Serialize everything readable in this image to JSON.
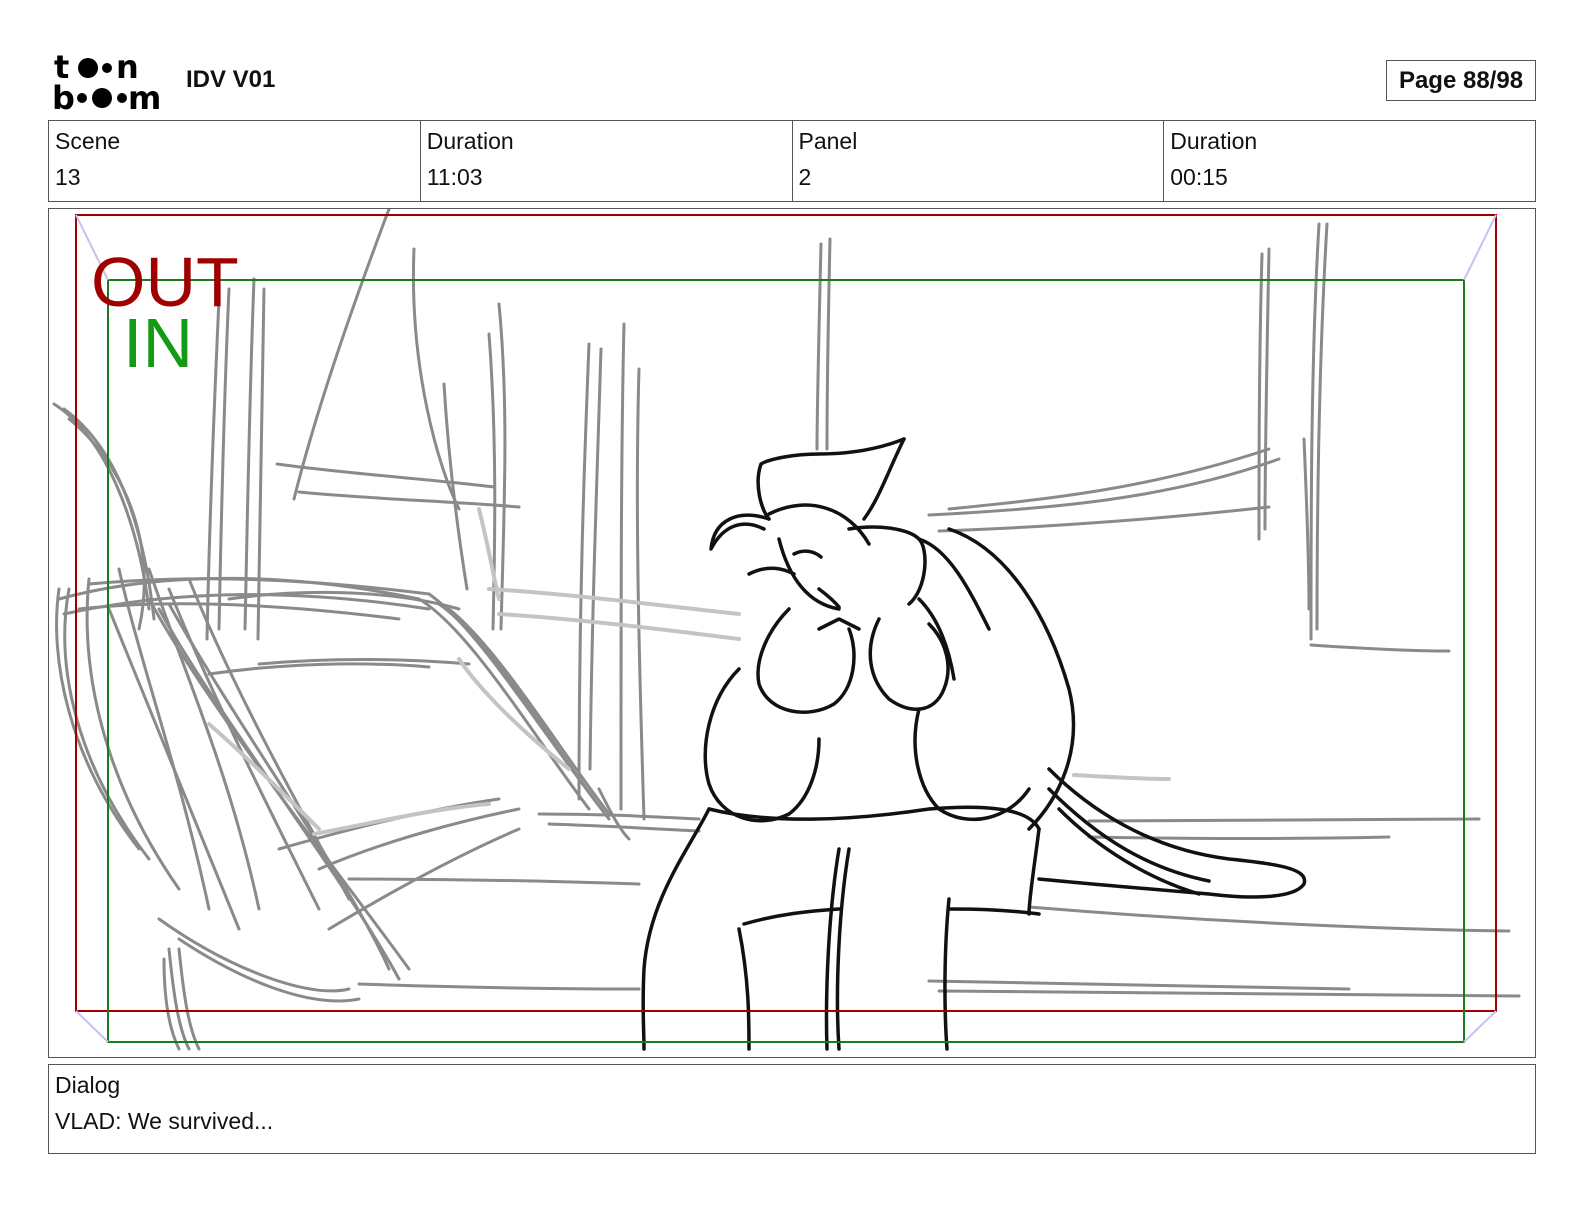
{
  "header": {
    "logo_text": "toon boom",
    "project_title": "IDV V01",
    "page_label": "Page 88/98"
  },
  "info": {
    "scene_label": "Scene",
    "scene_value": "13",
    "scene_duration_label": "Duration",
    "scene_duration_value": "11:03",
    "panel_label": "Panel",
    "panel_value": "2",
    "panel_duration_label": "Duration",
    "panel_duration_value": "00:15"
  },
  "panel_frame": {
    "out_label": "OUT",
    "in_label": "IN",
    "out_color": "#a00000",
    "in_color": "#159a15"
  },
  "dialog": {
    "label": "Dialog",
    "text": "VLAD: We survived..."
  }
}
